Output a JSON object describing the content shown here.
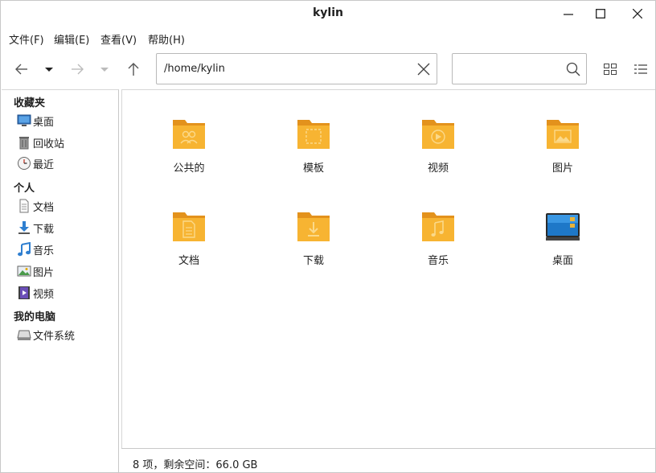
{
  "window": {
    "title": "kylin"
  },
  "menu": [
    {
      "label": "文件(F)"
    },
    {
      "label": "编辑(E)"
    },
    {
      "label": "查看(V)"
    },
    {
      "label": "帮助(H)"
    }
  ],
  "toolbar": {
    "path": "/home/kylin",
    "search_placeholder": ""
  },
  "sidebar": {
    "sections": [
      {
        "header": "收藏夹",
        "items": [
          {
            "label": "桌面",
            "icon": "desktop-icon"
          },
          {
            "label": "回收站",
            "icon": "trash-icon"
          },
          {
            "label": "最近",
            "icon": "clock-icon"
          }
        ]
      },
      {
        "header": "个人",
        "items": [
          {
            "label": "文档",
            "icon": "document-icon"
          },
          {
            "label": "下载",
            "icon": "download-icon"
          },
          {
            "label": "音乐",
            "icon": "music-icon"
          },
          {
            "label": "图片",
            "icon": "picture-icon"
          },
          {
            "label": "视频",
            "icon": "video-icon"
          }
        ]
      },
      {
        "header": "我的电脑",
        "items": [
          {
            "label": "文件系统",
            "icon": "drive-icon"
          }
        ]
      }
    ]
  },
  "files": [
    {
      "label": "公共的",
      "icon": "folder-public-icon"
    },
    {
      "label": "模板",
      "icon": "folder-templates-icon"
    },
    {
      "label": "视频",
      "icon": "folder-videos-icon"
    },
    {
      "label": "图片",
      "icon": "folder-pictures-icon"
    },
    {
      "label": "文档",
      "icon": "folder-documents-icon"
    },
    {
      "label": "下载",
      "icon": "folder-download-icon"
    },
    {
      "label": "音乐",
      "icon": "folder-music-icon"
    },
    {
      "label": "桌面",
      "icon": "desktop-folder-icon"
    }
  ],
  "status": {
    "text": "8 项，剩余空间：66.0 GB"
  },
  "colors": {
    "folder": "#f5a623",
    "folder_light": "#f9c45a",
    "accent": "#3b8ed8"
  }
}
